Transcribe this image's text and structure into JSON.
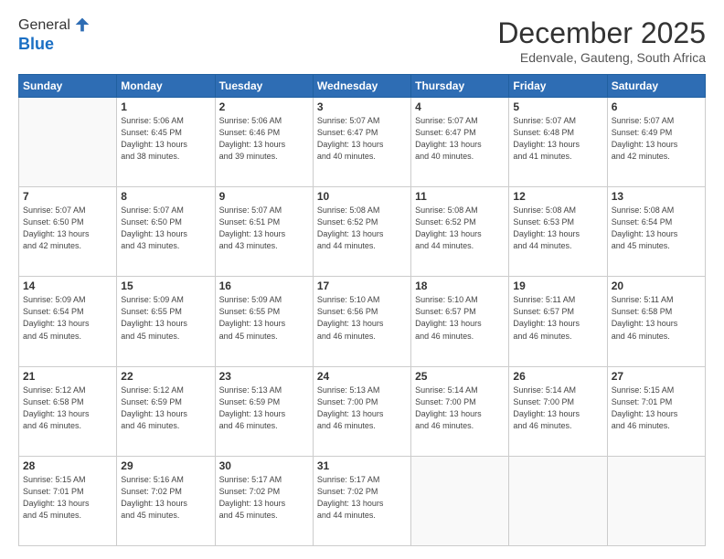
{
  "header": {
    "logo_line1": "General",
    "logo_line2": "Blue",
    "month": "December 2025",
    "location": "Edenvale, Gauteng, South Africa"
  },
  "days": [
    "Sunday",
    "Monday",
    "Tuesday",
    "Wednesday",
    "Thursday",
    "Friday",
    "Saturday"
  ],
  "weeks": [
    [
      {
        "num": "",
        "info": ""
      },
      {
        "num": "1",
        "info": "Sunrise: 5:06 AM\nSunset: 6:45 PM\nDaylight: 13 hours\nand 38 minutes."
      },
      {
        "num": "2",
        "info": "Sunrise: 5:06 AM\nSunset: 6:46 PM\nDaylight: 13 hours\nand 39 minutes."
      },
      {
        "num": "3",
        "info": "Sunrise: 5:07 AM\nSunset: 6:47 PM\nDaylight: 13 hours\nand 40 minutes."
      },
      {
        "num": "4",
        "info": "Sunrise: 5:07 AM\nSunset: 6:47 PM\nDaylight: 13 hours\nand 40 minutes."
      },
      {
        "num": "5",
        "info": "Sunrise: 5:07 AM\nSunset: 6:48 PM\nDaylight: 13 hours\nand 41 minutes."
      },
      {
        "num": "6",
        "info": "Sunrise: 5:07 AM\nSunset: 6:49 PM\nDaylight: 13 hours\nand 42 minutes."
      }
    ],
    [
      {
        "num": "7",
        "info": "Sunrise: 5:07 AM\nSunset: 6:50 PM\nDaylight: 13 hours\nand 42 minutes."
      },
      {
        "num": "8",
        "info": "Sunrise: 5:07 AM\nSunset: 6:50 PM\nDaylight: 13 hours\nand 43 minutes."
      },
      {
        "num": "9",
        "info": "Sunrise: 5:07 AM\nSunset: 6:51 PM\nDaylight: 13 hours\nand 43 minutes."
      },
      {
        "num": "10",
        "info": "Sunrise: 5:08 AM\nSunset: 6:52 PM\nDaylight: 13 hours\nand 44 minutes."
      },
      {
        "num": "11",
        "info": "Sunrise: 5:08 AM\nSunset: 6:52 PM\nDaylight: 13 hours\nand 44 minutes."
      },
      {
        "num": "12",
        "info": "Sunrise: 5:08 AM\nSunset: 6:53 PM\nDaylight: 13 hours\nand 44 minutes."
      },
      {
        "num": "13",
        "info": "Sunrise: 5:08 AM\nSunset: 6:54 PM\nDaylight: 13 hours\nand 45 minutes."
      }
    ],
    [
      {
        "num": "14",
        "info": "Sunrise: 5:09 AM\nSunset: 6:54 PM\nDaylight: 13 hours\nand 45 minutes."
      },
      {
        "num": "15",
        "info": "Sunrise: 5:09 AM\nSunset: 6:55 PM\nDaylight: 13 hours\nand 45 minutes."
      },
      {
        "num": "16",
        "info": "Sunrise: 5:09 AM\nSunset: 6:55 PM\nDaylight: 13 hours\nand 45 minutes."
      },
      {
        "num": "17",
        "info": "Sunrise: 5:10 AM\nSunset: 6:56 PM\nDaylight: 13 hours\nand 46 minutes."
      },
      {
        "num": "18",
        "info": "Sunrise: 5:10 AM\nSunset: 6:57 PM\nDaylight: 13 hours\nand 46 minutes."
      },
      {
        "num": "19",
        "info": "Sunrise: 5:11 AM\nSunset: 6:57 PM\nDaylight: 13 hours\nand 46 minutes."
      },
      {
        "num": "20",
        "info": "Sunrise: 5:11 AM\nSunset: 6:58 PM\nDaylight: 13 hours\nand 46 minutes."
      }
    ],
    [
      {
        "num": "21",
        "info": "Sunrise: 5:12 AM\nSunset: 6:58 PM\nDaylight: 13 hours\nand 46 minutes."
      },
      {
        "num": "22",
        "info": "Sunrise: 5:12 AM\nSunset: 6:59 PM\nDaylight: 13 hours\nand 46 minutes."
      },
      {
        "num": "23",
        "info": "Sunrise: 5:13 AM\nSunset: 6:59 PM\nDaylight: 13 hours\nand 46 minutes."
      },
      {
        "num": "24",
        "info": "Sunrise: 5:13 AM\nSunset: 7:00 PM\nDaylight: 13 hours\nand 46 minutes."
      },
      {
        "num": "25",
        "info": "Sunrise: 5:14 AM\nSunset: 7:00 PM\nDaylight: 13 hours\nand 46 minutes."
      },
      {
        "num": "26",
        "info": "Sunrise: 5:14 AM\nSunset: 7:00 PM\nDaylight: 13 hours\nand 46 minutes."
      },
      {
        "num": "27",
        "info": "Sunrise: 5:15 AM\nSunset: 7:01 PM\nDaylight: 13 hours\nand 46 minutes."
      }
    ],
    [
      {
        "num": "28",
        "info": "Sunrise: 5:15 AM\nSunset: 7:01 PM\nDaylight: 13 hours\nand 45 minutes."
      },
      {
        "num": "29",
        "info": "Sunrise: 5:16 AM\nSunset: 7:02 PM\nDaylight: 13 hours\nand 45 minutes."
      },
      {
        "num": "30",
        "info": "Sunrise: 5:17 AM\nSunset: 7:02 PM\nDaylight: 13 hours\nand 45 minutes."
      },
      {
        "num": "31",
        "info": "Sunrise: 5:17 AM\nSunset: 7:02 PM\nDaylight: 13 hours\nand 44 minutes."
      },
      {
        "num": "",
        "info": ""
      },
      {
        "num": "",
        "info": ""
      },
      {
        "num": "",
        "info": ""
      }
    ]
  ]
}
